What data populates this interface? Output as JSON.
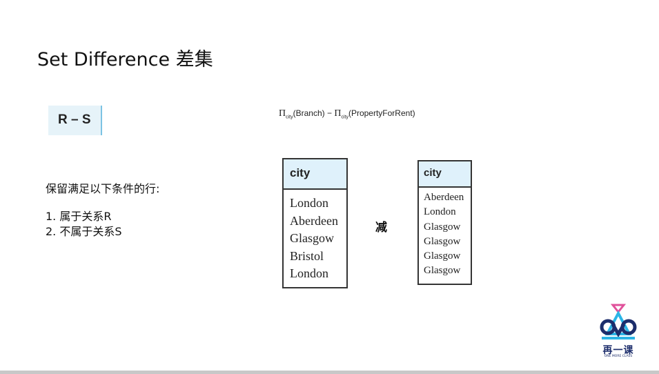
{
  "slide": {
    "title": "Set Difference 差集",
    "rs_label": "R – S",
    "formula": {
      "pi1": "Π",
      "sub1": "city",
      "arg1": "(Branch)",
      "op": " − ",
      "pi2": "Π",
      "sub2": "city",
      "arg2": "(PropertyForRent)"
    },
    "condition_title": "保留满足以下条件的行:",
    "conditions": [
      "1. 属于关系R",
      "2. 不属于关系S"
    ],
    "minus_label": "减",
    "relation_r": {
      "header": "city",
      "rows": [
        "London",
        "Aberdeen",
        "Glasgow",
        "Bristol",
        "London"
      ]
    },
    "relation_s": {
      "header": "city",
      "rows": [
        "Aberdeen",
        "London",
        "Glasgow",
        "Glasgow",
        "Glasgow",
        "Glasgow"
      ]
    },
    "logo": {
      "text": "再一课",
      "subtext": "ONE MORE CLASS",
      "colors": {
        "navy": "#1c2d6b",
        "cyan": "#2bb5e6",
        "pink": "#e0509a"
      }
    }
  }
}
